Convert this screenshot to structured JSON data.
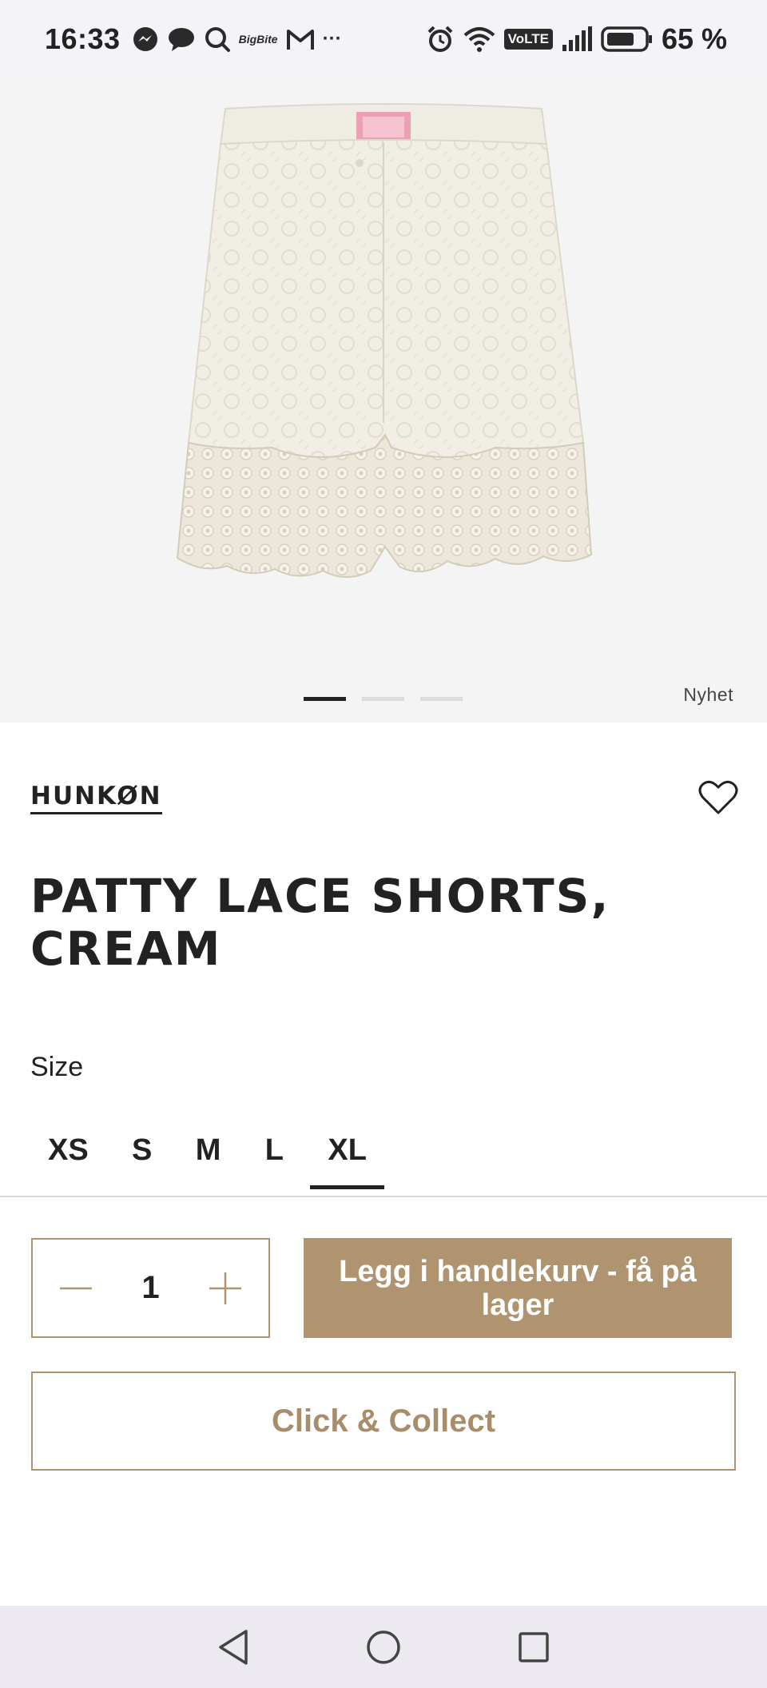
{
  "status_bar": {
    "time": "16:33",
    "notification_icons": [
      "messenger-icon",
      "chat-icon",
      "search-icon",
      "bigbite-icon",
      "gmail-icon",
      "more-icon"
    ],
    "system_icons": [
      "alarm-icon",
      "wifi-icon",
      "volte-icon",
      "signal-icon",
      "battery-icon"
    ],
    "volte_label": "VoLTE",
    "bigbite_label": "BigBite",
    "more_label": "···",
    "battery_text": "65 %"
  },
  "gallery": {
    "image_count": 3,
    "active_index": 0,
    "badge": "Nyhet"
  },
  "product": {
    "brand": "HUNKØN",
    "title": "PATTY LACE SHORTS, CREAM",
    "wishlist_icon": "heart-icon"
  },
  "size": {
    "label": "Size",
    "options": [
      "XS",
      "S",
      "M",
      "L",
      "XL"
    ],
    "selected": "XL"
  },
  "purchase": {
    "quantity": "1",
    "add_to_cart_label": "Legg i handlekurv - få på lager",
    "click_collect_label": "Click & Collect"
  },
  "colors": {
    "accent": "#b0946f",
    "accent_text": "#a88d6a",
    "text": "#222222",
    "image_bg": "#f4f4f4"
  },
  "nav_bar": {
    "buttons": [
      "back-icon",
      "home-icon",
      "recents-icon"
    ]
  }
}
